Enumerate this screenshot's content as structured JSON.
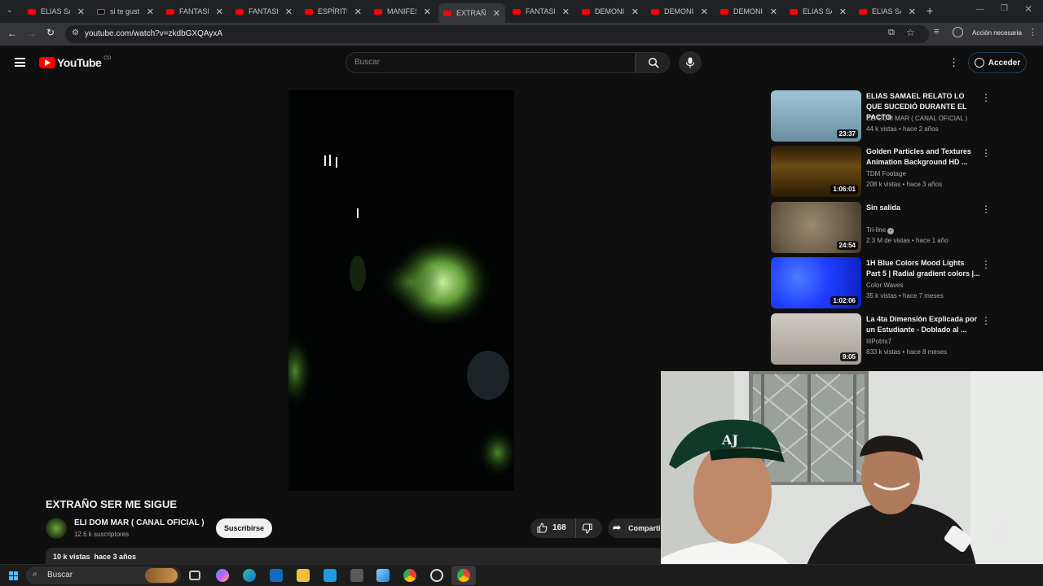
{
  "browser": {
    "tabs": [
      {
        "label": "ELIAS SAM",
        "icon": "youtube-icon"
      },
      {
        "label": "si te gusta",
        "icon": "tiktok-icon"
      },
      {
        "label": "FANTASM",
        "icon": "youtube-icon"
      },
      {
        "label": "FANTASM",
        "icon": "youtube-icon"
      },
      {
        "label": "ESPÍRITU T",
        "icon": "youtube-icon"
      },
      {
        "label": "MANIFEST",
        "icon": "youtube-icon"
      },
      {
        "label": "EXTRAÑO",
        "icon": "youtube-icon",
        "active": true
      },
      {
        "label": "FANTASM",
        "icon": "youtube-icon"
      },
      {
        "label": "DEMONIO",
        "icon": "youtube-icon"
      },
      {
        "label": "DEMONIO",
        "icon": "youtube-icon"
      },
      {
        "label": "DEMONIO",
        "icon": "youtube-icon"
      },
      {
        "label": "ELIAS SAM",
        "icon": "youtube-icon"
      },
      {
        "label": "ELIAS SAM",
        "icon": "youtube-icon"
      }
    ],
    "url": "youtube.com/watch?v=zkdbGXQAyxA",
    "action_label": "Acción necesaria"
  },
  "youtube": {
    "logo_text": "YouTube",
    "country": "CO",
    "search_placeholder": "Buscar",
    "signin_label": "Acceder"
  },
  "video": {
    "title": "EXTRAÑO SER ME SIGUE",
    "channel": "ELI DOM MAR ( CANAL OFICIAL )",
    "subscribers": "12.6 k suscriptores",
    "subscribe_label": "Suscribirse",
    "likes": "168",
    "share_label": "Compartir",
    "views_date": "10 k vistas  hace 3 años"
  },
  "recommendations": [
    {
      "title": "ELIAS SAMAEL RELATO LO QUE SUCEDIÓ DURANTE  EL PACTO",
      "channel": "ELI DOM MAR ( CANAL OFICIAL )",
      "meta": "44 k vistas • hace 2 años",
      "duration": "23:37"
    },
    {
      "title": "Golden Particles and Textures Animation Background HD ...",
      "channel": "TDM Footage",
      "meta": "208 k vistas • hace 3 años",
      "duration": "1:06:01"
    },
    {
      "title": "Sin salida",
      "channel": "Tri-line",
      "meta": "2.3 M de vistas • hace 1 año",
      "duration": "24:54",
      "verified": true
    },
    {
      "title": "1H  Blue  Colors Mood Lights Part 5 | Radial gradient colors |...",
      "channel": "Color Waves",
      "meta": "35 k vistas • hace 7 meses",
      "duration": "1:02:06"
    },
    {
      "title": "La 4ta Dimensión Explicada por un Estudiante - Doblado al ...",
      "channel": "IlIPotris7",
      "meta": "833 k vistas • hace 8 meses",
      "duration": "9:05"
    }
  ],
  "taskbar": {
    "search_label": "Buscar"
  }
}
